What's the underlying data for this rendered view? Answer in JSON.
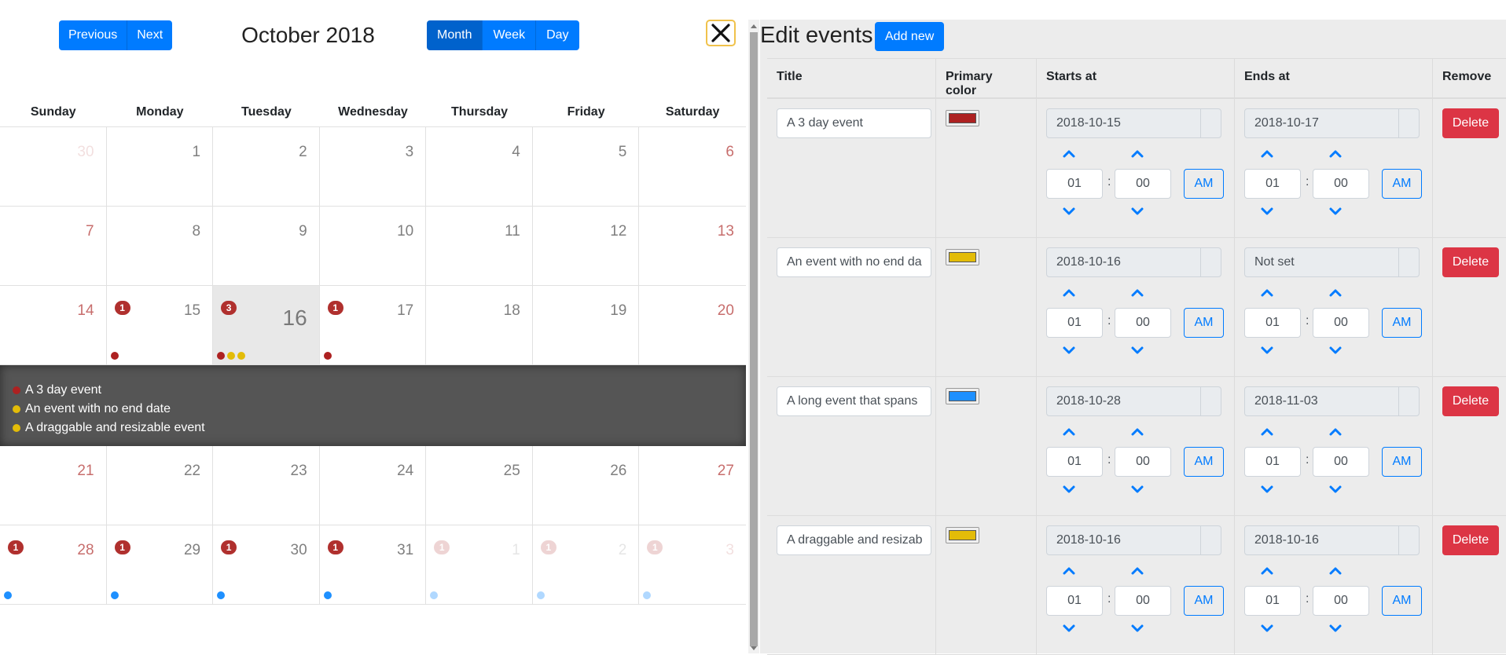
{
  "toolbar": {
    "previous_label": "Previous",
    "next_label": "Next",
    "month_title": "October 2018",
    "views": [
      {
        "label": "Month",
        "active": true
      },
      {
        "label": "Week",
        "active": false
      },
      {
        "label": "Day",
        "active": false
      }
    ]
  },
  "calendar": {
    "weekdays": [
      "Sunday",
      "Monday",
      "Tuesday",
      "Wednesday",
      "Thursday",
      "Friday",
      "Saturday"
    ],
    "weeks": [
      [
        {
          "day": "30",
          "out": true,
          "weekend": true
        },
        {
          "day": "1"
        },
        {
          "day": "2"
        },
        {
          "day": "3"
        },
        {
          "day": "4"
        },
        {
          "day": "5"
        },
        {
          "day": "6",
          "weekend": true
        }
      ],
      [
        {
          "day": "7",
          "weekend": true
        },
        {
          "day": "8"
        },
        {
          "day": "9"
        },
        {
          "day": "10"
        },
        {
          "day": "11"
        },
        {
          "day": "12"
        },
        {
          "day": "13",
          "weekend": true
        }
      ],
      [
        {
          "day": "14",
          "weekend": true
        },
        {
          "day": "15",
          "badge": "1",
          "dots": [
            "#ad2121"
          ]
        },
        {
          "day": "16",
          "today": true,
          "badge": "3",
          "dots": [
            "#ad2121",
            "#e3bc08",
            "#e3bc08"
          ]
        },
        {
          "day": "17",
          "badge": "1",
          "dots": [
            "#ad2121"
          ]
        },
        {
          "day": "18"
        },
        {
          "day": "19"
        },
        {
          "day": "20",
          "weekend": true
        }
      ],
      [
        {
          "day": "21",
          "weekend": true
        },
        {
          "day": "22"
        },
        {
          "day": "23"
        },
        {
          "day": "24"
        },
        {
          "day": "25"
        },
        {
          "day": "26"
        },
        {
          "day": "27",
          "weekend": true
        }
      ],
      [
        {
          "day": "28",
          "weekend": true,
          "badge": "1",
          "dots": [
            "#1e90ff"
          ]
        },
        {
          "day": "29",
          "badge": "1",
          "dots": [
            "#1e90ff"
          ]
        },
        {
          "day": "30",
          "badge": "1",
          "dots": [
            "#1e90ff"
          ]
        },
        {
          "day": "31",
          "badge": "1",
          "dots": [
            "#1e90ff"
          ]
        },
        {
          "day": "1",
          "out": true,
          "badge": "1",
          "dots": [
            "#1e90ff"
          ]
        },
        {
          "day": "2",
          "out": true,
          "badge": "1",
          "dots": [
            "#1e90ff"
          ]
        },
        {
          "day": "3",
          "out": true,
          "weekend": true,
          "badge": "1",
          "dots": [
            "#1e90ff"
          ]
        }
      ]
    ],
    "open_day_events": [
      {
        "title": "A 3 day event",
        "color": "#ad2121"
      },
      {
        "title": "An event with no end date",
        "color": "#e3bc08"
      },
      {
        "title": "A draggable and resizable event",
        "color": "#e3bc08"
      }
    ]
  },
  "editor": {
    "title": "Edit events",
    "add_label": "Add new",
    "columns": [
      "Title",
      "Primary color",
      "Starts at",
      "Ends at",
      "Remove"
    ],
    "delete_label": "Delete",
    "colon": ":",
    "rows": [
      {
        "title": "A 3 day event",
        "color": "#ad2121",
        "start_date": "2018-10-15",
        "end_date": "2018-10-17",
        "start_hour": "01",
        "start_min": "00",
        "start_ampm": "AM",
        "end_hour": "01",
        "end_min": "00",
        "end_ampm": "AM"
      },
      {
        "title": "An event with no end da",
        "color": "#e3bc08",
        "start_date": "2018-10-16",
        "end_date": "Not set",
        "start_hour": "01",
        "start_min": "00",
        "start_ampm": "AM",
        "end_hour": "01",
        "end_min": "00",
        "end_ampm": "AM"
      },
      {
        "title": "A long event that spans",
        "color": "#1e90ff",
        "start_date": "2018-10-28",
        "end_date": "2018-11-03",
        "start_hour": "01",
        "start_min": "00",
        "start_ampm": "AM",
        "end_hour": "01",
        "end_min": "00",
        "end_ampm": "AM"
      },
      {
        "title": "A draggable and resizab",
        "color": "#e3bc08",
        "start_date": "2018-10-16",
        "end_date": "2018-10-16",
        "start_hour": "01",
        "start_min": "00",
        "start_ampm": "AM",
        "end_hour": "01",
        "end_min": "00",
        "end_ampm": "AM"
      }
    ]
  },
  "icons": {
    "close": "close-icon",
    "chevron_up": "chevron-up-icon",
    "chevron_down": "chevron-down-icon"
  }
}
